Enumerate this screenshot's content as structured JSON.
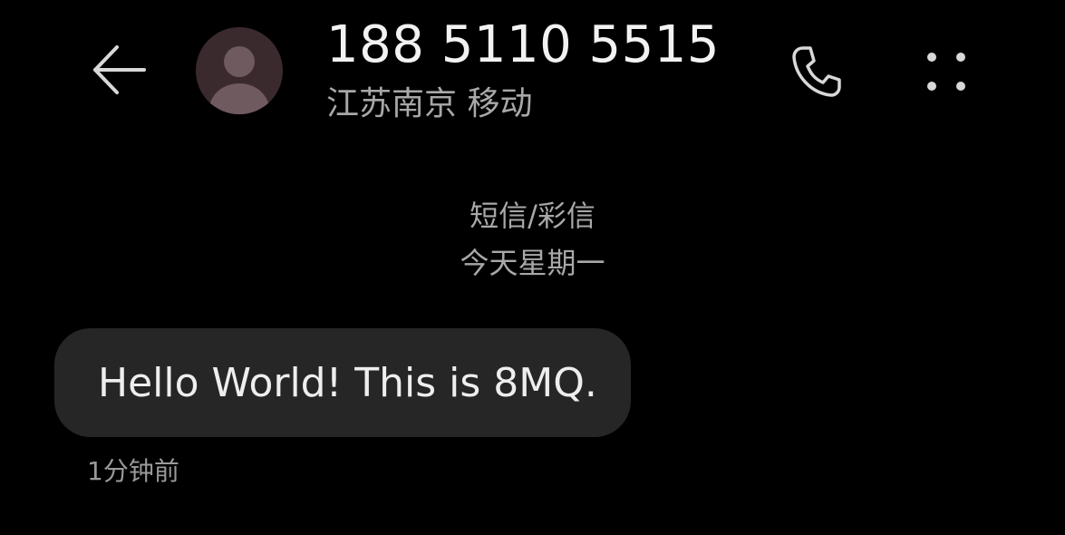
{
  "header": {
    "back_icon": "arrow-left-icon",
    "avatar_icon": "person-icon",
    "contact_number": "188 5110 5515",
    "contact_location": "江苏南京 移动",
    "call_icon": "phone-icon",
    "more_icon": "more-dots-icon"
  },
  "conversation": {
    "channel_label": "短信/彩信",
    "date_label": "今天星期一",
    "messages": [
      {
        "text": "Hello World! This is 8MQ.",
        "time": "1分钟前"
      }
    ]
  },
  "colors": {
    "background": "#000000",
    "bubble": "#262626",
    "primary_text": "#f2f2f2",
    "secondary_text": "#a8a8a8",
    "avatar_bg": "#3a2a2e",
    "avatar_fg": "#6e5a5f"
  }
}
